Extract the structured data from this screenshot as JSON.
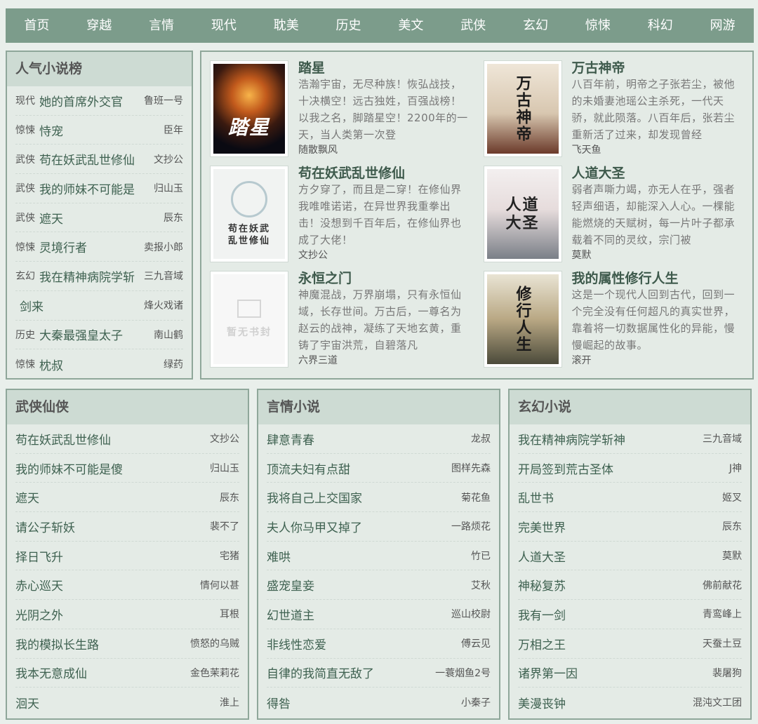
{
  "nav": [
    "首页",
    "穿越",
    "言情",
    "现代",
    "耽美",
    "历史",
    "美文",
    "武侠",
    "玄幻",
    "惊悚",
    "科幻",
    "网游"
  ],
  "popular": {
    "title": "人气小说榜",
    "items": [
      {
        "cat": "现代",
        "title": "她的首席外交官",
        "author": "鲁班一号"
      },
      {
        "cat": "惊悚",
        "title": "恃宠",
        "author": "臣年"
      },
      {
        "cat": "武侠",
        "title": "苟在妖武乱世修仙",
        "author": "文抄公"
      },
      {
        "cat": "武侠",
        "title": "我的师妹不可能是",
        "author": "归山玉"
      },
      {
        "cat": "武侠",
        "title": "遮天",
        "author": "辰东"
      },
      {
        "cat": "惊悚",
        "title": "灵境行者",
        "author": "卖报小郎"
      },
      {
        "cat": "玄幻",
        "title": "我在精神病院学斩",
        "author": "三九音域"
      },
      {
        "cat": "",
        "title": "剑来",
        "author": "烽火戏诸"
      },
      {
        "cat": "历史",
        "title": "大秦最强皇太子",
        "author": "南山鹤"
      },
      {
        "cat": "惊悚",
        "title": "枕叔",
        "author": "绿药"
      }
    ]
  },
  "featured": [
    {
      "title": "踏星",
      "desc": "浩瀚宇宙，无尽种族！恢弘战技，十决横空！远古独姓，百强战榜！以我之名，脚踏星空！2200年的一天，当人类第一次登",
      "author": "随散飘风",
      "cover_text": "踏星",
      "cover_sub": ""
    },
    {
      "title": "万古神帝",
      "desc": "八百年前，明帝之子张若尘，被他的未婚妻池瑶公主杀死，一代天骄，就此陨落。八百年后，张若尘重新活了过来，却发现曾经",
      "author": "飞天鱼",
      "cover_text": "万古神帝",
      "cover_sub": ""
    },
    {
      "title": "苟在妖武乱世修仙",
      "desc": "方夕穿了，而且是二穿！在修仙界我唯唯诺诺，在异世界我重拳出击！没想到千百年后，在修仙界也成了大佬！",
      "author": "文抄公",
      "cover_text": "苟在妖武乱世修仙",
      "cover_sub": ""
    },
    {
      "title": "人道大圣",
      "desc": "弱者声嘶力竭，亦无人在乎，强者轻声细语，却能深入人心。一棵能能燃烧的天赋树，每一片叶子都承载着不同的灵纹，宗门被",
      "author": "莫默",
      "cover_text": "人道大圣",
      "cover_sub": ""
    },
    {
      "title": "永恒之门",
      "desc": "神魔混战，万界崩塌，只有永恒仙域，长存世间。万古后，一尊名为赵云的战神，凝练了天地玄黄，重铸了宇宙洪荒，自碧落凡",
      "author": "六界三道",
      "cover_text": "暂无书封",
      "cover_sub": ""
    },
    {
      "title": "我的属性修行人生",
      "desc": "这是一个现代人回到古代，回到一个完全没有任何超凡的真实世界，靠着将一切数据属性化的异能，慢慢崛起的故事。",
      "author": "滚开",
      "cover_text": "修行人生",
      "cover_sub": ""
    }
  ],
  "lists": [
    {
      "title": "武侠仙侠",
      "items": [
        {
          "title": "苟在妖武乱世修仙",
          "author": "文抄公"
        },
        {
          "title": "我的师妹不可能是傻",
          "author": "归山玉"
        },
        {
          "title": "遮天",
          "author": "辰东"
        },
        {
          "title": "请公子斩妖",
          "author": "裴不了"
        },
        {
          "title": "择日飞升",
          "author": "宅猪"
        },
        {
          "title": "赤心巡天",
          "author": "情何以甚"
        },
        {
          "title": "光阴之外",
          "author": "耳根"
        },
        {
          "title": "我的模拟长生路",
          "author": "愤怒的乌贼"
        },
        {
          "title": "我本无意成仙",
          "author": "金色茉莉花"
        },
        {
          "title": "洄天",
          "author": "淮上"
        }
      ]
    },
    {
      "title": "言情小说",
      "items": [
        {
          "title": "肆意青春",
          "author": "龙叔"
        },
        {
          "title": "顶流夫妇有点甜",
          "author": "图样先森"
        },
        {
          "title": "我将自己上交国家",
          "author": "菊花鱼"
        },
        {
          "title": "夫人你马甲又掉了",
          "author": "一路烦花"
        },
        {
          "title": "难哄",
          "author": "竹已"
        },
        {
          "title": "盛宠皇妾",
          "author": "艾秋"
        },
        {
          "title": "幻世道主",
          "author": "巡山校尉"
        },
        {
          "title": "非线性恋爱",
          "author": "傅云见"
        },
        {
          "title": "自律的我简直无敌了",
          "author": "一蓑烟鱼2号"
        },
        {
          "title": "得咎",
          "author": "小秦子"
        }
      ]
    },
    {
      "title": "玄幻小说",
      "items": [
        {
          "title": "我在精神病院学斩神",
          "author": "三九音域"
        },
        {
          "title": "开局签到荒古圣体",
          "author": "J神"
        },
        {
          "title": "乱世书",
          "author": "姬叉"
        },
        {
          "title": "完美世界",
          "author": "辰东"
        },
        {
          "title": "人道大圣",
          "author": "莫默"
        },
        {
          "title": "神秘复苏",
          "author": "佛前献花"
        },
        {
          "title": "我有一剑",
          "author": "青鸾峰上"
        },
        {
          "title": "万相之王",
          "author": "天蚕土豆"
        },
        {
          "title": "诸界第一因",
          "author": "裴屠狗"
        },
        {
          "title": "美漫丧钟",
          "author": "混沌文工团"
        }
      ]
    }
  ]
}
